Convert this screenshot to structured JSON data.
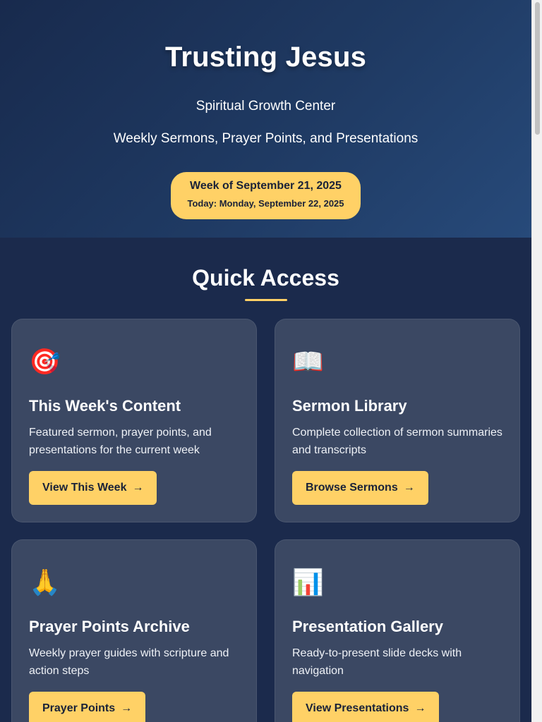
{
  "hero": {
    "title": "Trusting Jesus",
    "subtitle": "Spiritual Growth Center",
    "tagline": "Weekly Sermons, Prayer Points, and Presentations",
    "week_label": "Week of September 21, 2025",
    "today_label": "Today: Monday, September 22, 2025"
  },
  "quick_access": {
    "title": "Quick Access",
    "cards": [
      {
        "icon": "🎯",
        "icon_name": "target-icon",
        "title": "This Week's Content",
        "description": "Featured sermon, prayer points, and presentations for the current week",
        "button": "View This Week"
      },
      {
        "icon": "📖",
        "icon_name": "book-icon",
        "title": "Sermon Library",
        "description": "Complete collection of sermon summaries and transcripts",
        "button": "Browse Sermons"
      },
      {
        "icon": "🙏",
        "icon_name": "praying-hands-icon",
        "title": "Prayer Points Archive",
        "description": "Weekly prayer guides with scripture and action steps",
        "button": "Prayer Points"
      },
      {
        "icon": "📊",
        "icon_name": "bar-chart-icon",
        "title": "Presentation Gallery",
        "description": "Ready-to-present slide decks with navigation",
        "button": "View Presentations"
      }
    ],
    "arrow": "→"
  },
  "colors": {
    "accent": "#ffd166",
    "hero_bg_start": "#182a4d",
    "hero_bg_end": "#274a7a",
    "main_bg": "#1b2a4c",
    "card_bg": "#3b4863"
  }
}
